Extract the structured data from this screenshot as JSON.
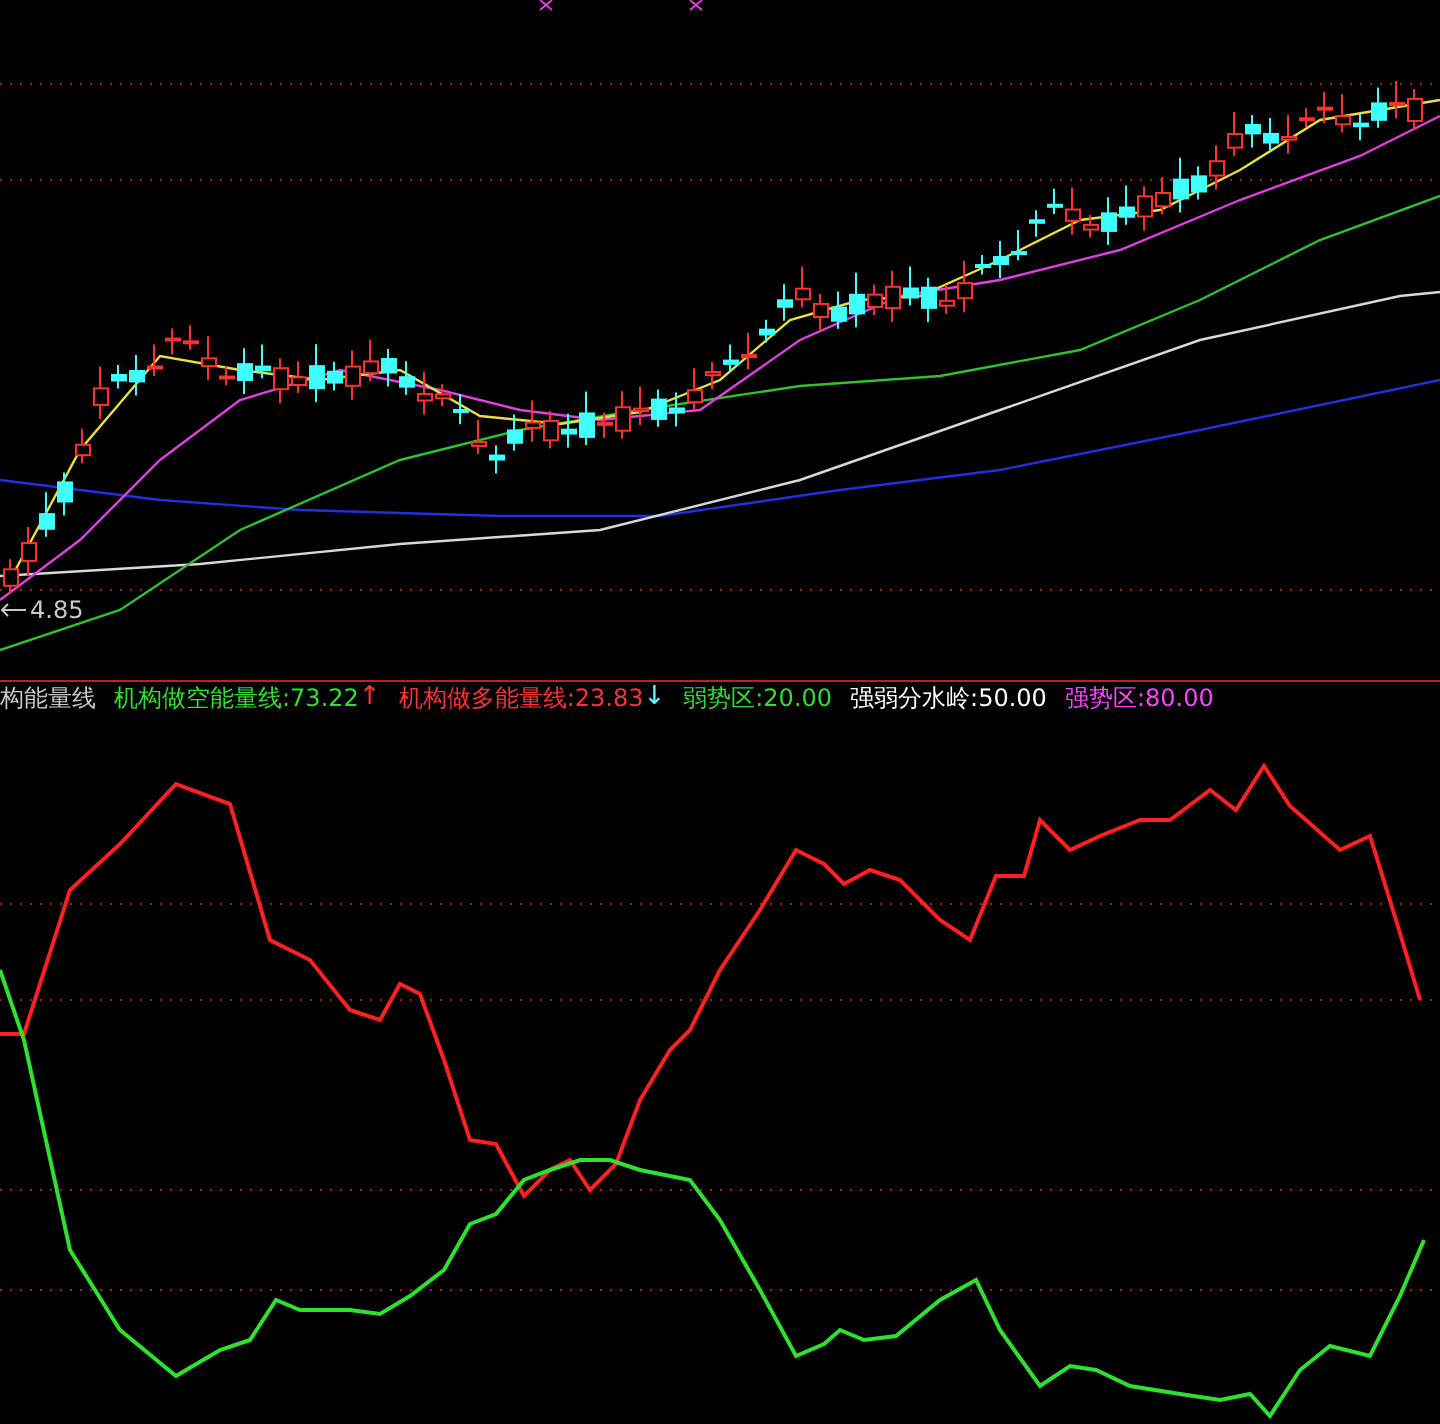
{
  "price_panel": {
    "low_marker": "4.85"
  },
  "indicator_panel": {
    "legend": [
      {
        "text": "构能量线",
        "color": "#c8c8c8"
      },
      {
        "text": "机构做空能量线:73.22",
        "color": "#33dd33",
        "arrow": {
          "text": "↑",
          "color": "#ff3030"
        }
      },
      {
        "text": "机构做多能量线:23.83",
        "color": "#ff3333",
        "arrow": {
          "text": "↓",
          "color": "#66ffff"
        }
      },
      {
        "text": "弱势区:20.00",
        "color": "#33dd33"
      },
      {
        "text": "强弱分水岭:50.00",
        "color": "#ffffff"
      },
      {
        "text": "强势区:80.00",
        "color": "#ff44ff"
      }
    ]
  }
}
